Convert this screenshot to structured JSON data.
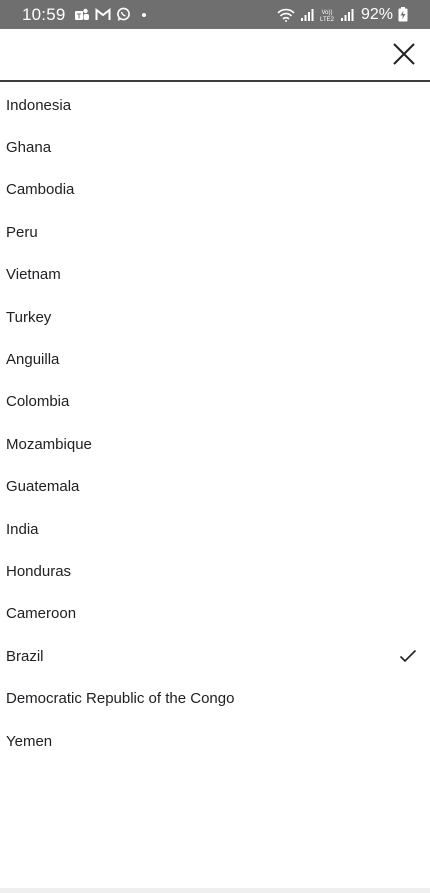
{
  "status_bar": {
    "time": "10:59",
    "battery": "92%",
    "icons": [
      "teams-icon",
      "gmail-icon",
      "whatsapp-icon",
      "wifi-icon",
      "signal-icon",
      "volte-icon",
      "battery-charging-icon"
    ]
  },
  "header": {
    "close_icon": "close-icon"
  },
  "countries": [
    {
      "name": "Indonesia",
      "selected": false
    },
    {
      "name": "Ghana",
      "selected": false
    },
    {
      "name": "Cambodia",
      "selected": false
    },
    {
      "name": "Peru",
      "selected": false
    },
    {
      "name": "Vietnam",
      "selected": false
    },
    {
      "name": "Turkey",
      "selected": false
    },
    {
      "name": "Anguilla",
      "selected": false
    },
    {
      "name": "Colombia",
      "selected": false
    },
    {
      "name": "Mozambique",
      "selected": false
    },
    {
      "name": "Guatemala",
      "selected": false
    },
    {
      "name": "India",
      "selected": false
    },
    {
      "name": "Honduras",
      "selected": false
    },
    {
      "name": "Cameroon",
      "selected": false
    },
    {
      "name": "Brazil",
      "selected": true
    },
    {
      "name": "Democratic Republic of the Congo",
      "selected": false
    },
    {
      "name": "Yemen",
      "selected": false
    }
  ],
  "colors": {
    "status_bar_bg": "#6f6f6f",
    "text": "#202124",
    "divider": "#3c3c3c"
  }
}
